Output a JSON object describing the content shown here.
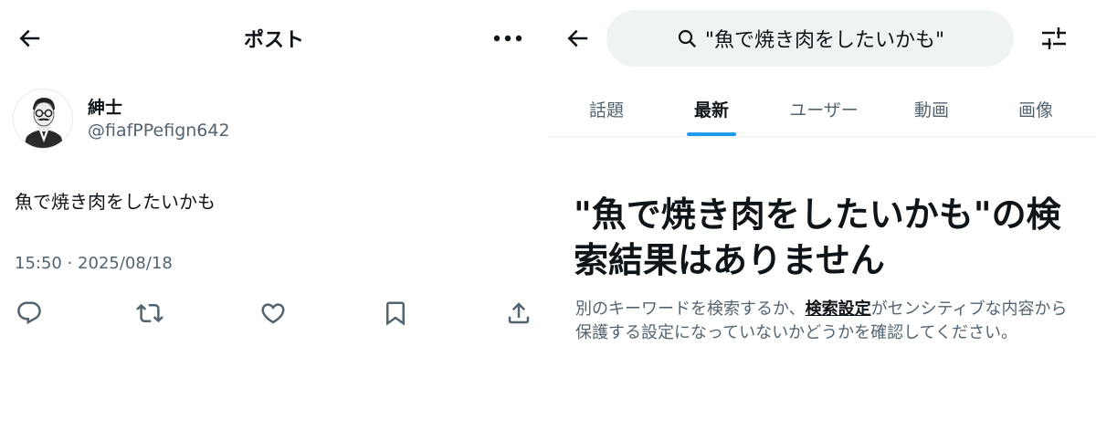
{
  "post_view": {
    "title": "ポスト",
    "author": {
      "display_name": "紳士",
      "handle": "@fiafPPefign642"
    },
    "text": "魚で焼き肉をしたいかも",
    "timestamp": "15:50 · 2025/08/18",
    "icons": {
      "back": "arrow-left-icon",
      "more": "more-horizontal-icon",
      "reply": "reply-icon",
      "repost": "repost-icon",
      "like": "heart-icon",
      "bookmark": "bookmark-icon",
      "share": "share-icon"
    }
  },
  "search_view": {
    "query": "\"魚で焼き肉をしたいかも\"",
    "tabs": [
      {
        "label": "話題"
      },
      {
        "label": "最新",
        "active": true
      },
      {
        "label": "ユーザー"
      },
      {
        "label": "動画"
      },
      {
        "label": "画像"
      }
    ],
    "empty_title": "\"魚で焼き肉をしたいかも\"の検索結果はありません",
    "empty_desc_before": "別のキーワードを検索するか、",
    "empty_desc_link": "検索設定",
    "empty_desc_after": "がセンシティブな内容から保護する設定になっていないかどうかを確認してください。",
    "icons": {
      "back": "arrow-left-icon",
      "search": "search-icon",
      "filter": "filter-sliders-icon"
    }
  },
  "colors": {
    "text_primary": "#0f1419",
    "text_secondary": "#536471",
    "accent": "#1d9bf0",
    "search_bg": "#eff3f4"
  }
}
